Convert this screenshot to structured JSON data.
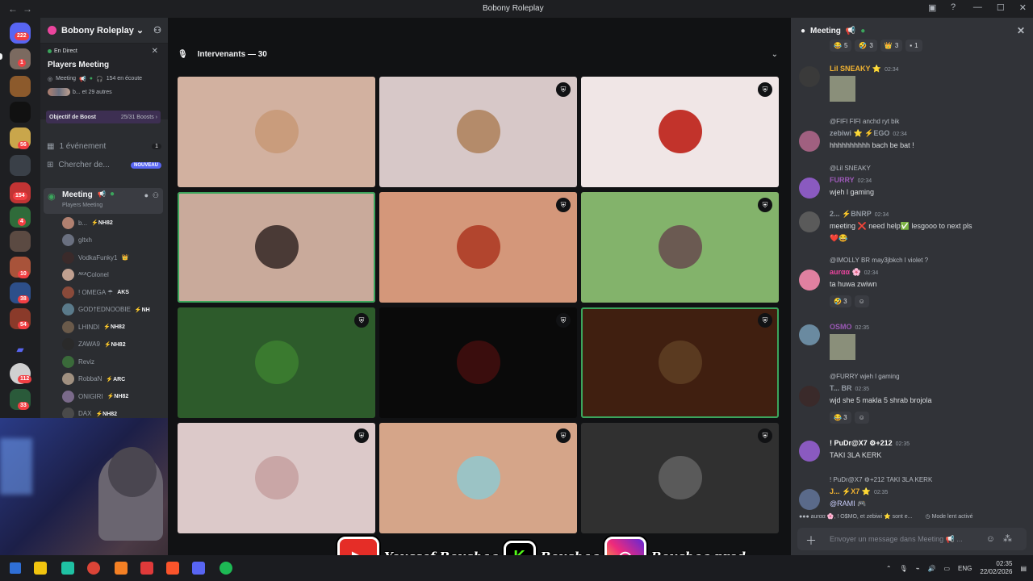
{
  "window": {
    "title": "Bobony Roleplay"
  },
  "guilds": {
    "badges": [
      "222",
      "1",
      "56",
      "154",
      "4",
      "10",
      "38",
      "54",
      "112",
      "33"
    ]
  },
  "sidebar": {
    "server_name": "Bobony Roleplay",
    "live": {
      "status": "En Direct",
      "event_title": "Players Meeting",
      "channel": "Meeting",
      "listeners": "154 en écoute",
      "others": "b... et 29 autres"
    },
    "boost": {
      "label": "Objectif de Boost",
      "progress": "25/31 Boosts"
    },
    "events": {
      "label": "1 événement",
      "count": "1"
    },
    "browse": {
      "label": "Chercher de...",
      "badge": "NOUVEAU"
    },
    "voice_channel": {
      "name": "Meeting",
      "subtitle": "Players Meeting"
    },
    "members": [
      {
        "name": "b...",
        "tag": "⚡NH82"
      },
      {
        "name": "gltxh",
        "tag": ""
      },
      {
        "name": "VodkaFunky1",
        "tag": "👑"
      },
      {
        "name": "ᴬᴷᴬColonel",
        "tag": ""
      },
      {
        "name": "! OMEGA ☂",
        "tag": "AKS"
      },
      {
        "name": "GOD†EDNOOBIE",
        "tag": "⚡NH"
      },
      {
        "name": "LHINDI",
        "tag": "⚡NH82"
      },
      {
        "name": "ZAWA9",
        "tag": "⚡NH82"
      },
      {
        "name": "Reviz",
        "tag": ""
      },
      {
        "name": "RobbaN",
        "tag": "⚡ARC"
      },
      {
        "name": "ONIGIRI",
        "tag": "⚡NH82"
      },
      {
        "name": "DAX",
        "tag": "⚡NH82"
      }
    ]
  },
  "stage": {
    "header": "Intervenants — 30",
    "tiles": [
      {
        "bg": "#d2b1a0",
        "speaking": false,
        "moderator": false,
        "avatar": "#c99c7c"
      },
      {
        "bg": "#d7c8c8",
        "speaking": false,
        "moderator": true,
        "avatar": "#b48b6a"
      },
      {
        "bg": "#f0e6e6",
        "speaking": false,
        "moderator": true,
        "avatar": "#c2332b"
      },
      {
        "bg": "#c9aa9b",
        "speaking": true,
        "moderator": false,
        "avatar": "#4a3a36"
      },
      {
        "bg": "#d4977a",
        "speaking": false,
        "moderator": true,
        "avatar": "#b2452e"
      },
      {
        "bg": "#83b36b",
        "speaking": false,
        "moderator": true,
        "avatar": "#6b5a52"
      },
      {
        "bg": "#2d5b2b",
        "speaking": false,
        "moderator": true,
        "avatar": "#3a7a2f"
      },
      {
        "bg": "#0a0a0a",
        "speaking": false,
        "moderator": true,
        "avatar": "#3a0d0d"
      },
      {
        "bg": "#401f10",
        "speaking": true,
        "moderator": true,
        "avatar": "#5a3a20"
      },
      {
        "bg": "#dcc9c9",
        "speaking": false,
        "moderator": true,
        "avatar": "#c9a6a6"
      },
      {
        "bg": "#d5a589",
        "speaking": false,
        "moderator": true,
        "avatar": "#9bc3c5"
      },
      {
        "bg": "#303030",
        "speaking": false,
        "moderator": true,
        "avatar": "#5a5a5a"
      }
    ]
  },
  "chat": {
    "title": "Meeting",
    "top_reacts": [
      "5",
      "3",
      "3",
      "1"
    ],
    "messages": [
      {
        "author": "Lil SNEAKY ⭐",
        "time": "02:34",
        "reply": "",
        "text": "",
        "color": "#f0b232",
        "image": true
      },
      {
        "author": "zebiwi ⭐ ⚡EGO",
        "time": "02:34",
        "reply": "@FIFI  FIFI  anchd ryt bik",
        "text": "hhhhhhhhhh bach be bat !",
        "color": "#949ba4",
        "image": false
      },
      {
        "author": "FURRY",
        "time": "02:34",
        "reply": "@Lil SNEAKY",
        "text": "wjeh l gaming",
        "color": "#9b59b6",
        "image": false
      },
      {
        "author": "2... ⚡BNRP",
        "time": "02:34",
        "reply": "",
        "text": "meeting ❌  need help✅ lesgooo to next pls",
        "text2": "❤️😂",
        "color": "#949ba4",
        "image": false
      },
      {
        "author": "aurαα 🌸",
        "time": "02:34",
        "reply": "@IMOLLY  BR  may3jbkch l violet ?",
        "text": "ta huwa zwiwn",
        "color": "#eb459e",
        "image": false,
        "react": "🤣 3"
      },
      {
        "author": "OSMO",
        "time": "02:35",
        "reply": "",
        "text": "",
        "color": "#9b59b6",
        "image": true
      },
      {
        "author": "T... BR",
        "time": "02:35",
        "reply": "@FURRY wjeh l gaming",
        "text": "wjd she 5 makla 5 shrab brojola",
        "color": "#949ba4",
        "image": false,
        "react": "😂 3"
      },
      {
        "author": "! PuDr@X7 ⚙+212",
        "time": "02:35",
        "reply": "",
        "text": "TAKI 3LA KERK",
        "color": "#ffffff",
        "image": false
      },
      {
        "author": "J... ⚡X7 ⭐",
        "time": "02:35",
        "reply": "! PuDr@X7 ⚙+212  TAKI 3LA KERK",
        "text": "@RAMI 🎮",
        "color": "#f0b232",
        "image": false
      }
    ],
    "typing": "aurαα 🌸, ! O$MO, et zebiwi ⭐ sont e...",
    "slowmode": "Mode lent activé",
    "input_placeholder": "Envoyer un message dans Meeting 📢 ..."
  },
  "overlay": {
    "youtube": "Youssef Boushaq",
    "kick": "Boushaq",
    "instagram": "Boushaq.prod"
  },
  "taskbar": {
    "lang": "ENG",
    "time": "02:35",
    "date": "22/02/2026"
  }
}
